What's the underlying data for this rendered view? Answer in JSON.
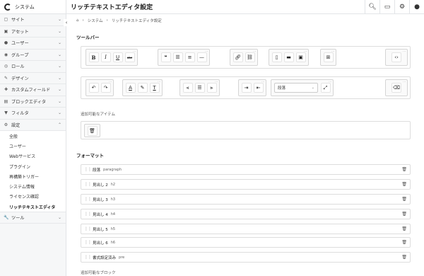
{
  "app": {
    "brand": "システム"
  },
  "header": {
    "title": "リッチテキストエディタ設定"
  },
  "breadcrumb": [
    "システム",
    "リッチテキストエディタ設定"
  ],
  "sidebar": {
    "items": [
      {
        "label": "サイト",
        "icon": "site-icon"
      },
      {
        "label": "アセット",
        "icon": "asset-icon"
      },
      {
        "label": "ユーザー",
        "icon": "user-icon"
      },
      {
        "label": "グループ",
        "icon": "group-icon"
      },
      {
        "label": "ロール",
        "icon": "role-icon"
      },
      {
        "label": "デザイン",
        "icon": "design-icon"
      },
      {
        "label": "カスタムフィールド",
        "icon": "custom-field-icon"
      },
      {
        "label": "ブロックエディタ",
        "icon": "block-editor-icon"
      },
      {
        "label": "フィルタ",
        "icon": "filter-icon"
      },
      {
        "label": "設定",
        "icon": "gear-icon"
      }
    ],
    "sub_items": [
      "全般",
      "ユーザー",
      "Webサービス",
      "プラグイン",
      "再構築トリガー",
      "システム情報",
      "ライセンス確認",
      "リッチテキストエディタ"
    ],
    "last_item": {
      "label": "ツール",
      "icon": "wrench-icon"
    }
  },
  "toolbar_section": {
    "title": "ツールバー"
  },
  "toolbar_row1": {
    "bold": "B",
    "italic": "I",
    "underline": "U",
    "strike": "abc",
    "quote": "❝",
    "hr": "—"
  },
  "toolbar_row2": {
    "text_color": "A",
    "clear_format": "T",
    "format_select": "段落"
  },
  "available_items_label": "追加可能なアイテム",
  "format_section": {
    "title": "フォーマット"
  },
  "formats": [
    {
      "name": "段落",
      "tag": "paragraph"
    },
    {
      "name": "見出し 2",
      "tag": "h2"
    },
    {
      "name": "見出し 3",
      "tag": "h3"
    },
    {
      "name": "見出し 4",
      "tag": "h4"
    },
    {
      "name": "見出し 5",
      "tag": "h5"
    },
    {
      "name": "見出し 6",
      "tag": "h6"
    },
    {
      "name": "書式設定済み",
      "tag": "pre"
    }
  ],
  "available_blocks_label": "追加可能なブロック"
}
